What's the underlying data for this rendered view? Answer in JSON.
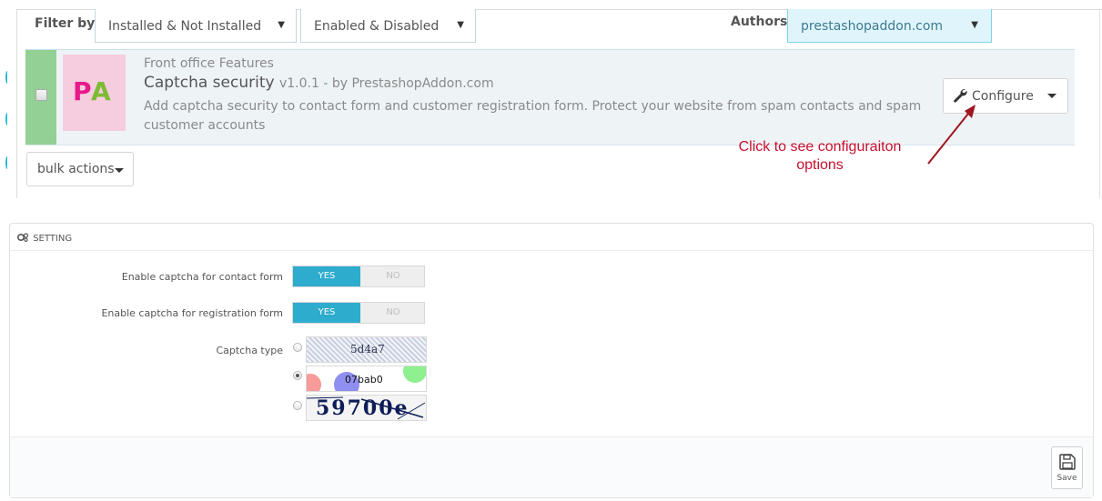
{
  "filters": {
    "label": "Filter by",
    "installed": "Installed & Not Installed",
    "enabled": "Enabled & Disabled",
    "authors_label": "Authors",
    "authors": "prestashopaddon.com"
  },
  "module": {
    "logo_text_p": "P",
    "logo_text_a": "A",
    "category": "Front office Features",
    "title": "Captcha security",
    "version": "v1.0.1 - by PrestashopAddon.com",
    "description": "Add captcha security to contact form and customer registration form. Protect your website from spam contacts and spam customer accounts",
    "configure_label": "Configure",
    "status_color": "#92d095"
  },
  "annotation": {
    "line1": "Click to see configuraiton",
    "line2": "options",
    "color": "#c8102e"
  },
  "bulk": {
    "label": "bulk actions"
  },
  "settings": {
    "heading": "SETTING",
    "contact_label": "Enable captcha for contact form",
    "registration_label": "Enable captcha for registration form",
    "yes": "YES",
    "no": "NO",
    "captcha_type_label": "Captcha type",
    "captchas": [
      "5d4a7",
      "07bab0",
      "59700e"
    ],
    "selected_captcha": 2,
    "save_label": "Save",
    "accent": "#2eacce"
  }
}
